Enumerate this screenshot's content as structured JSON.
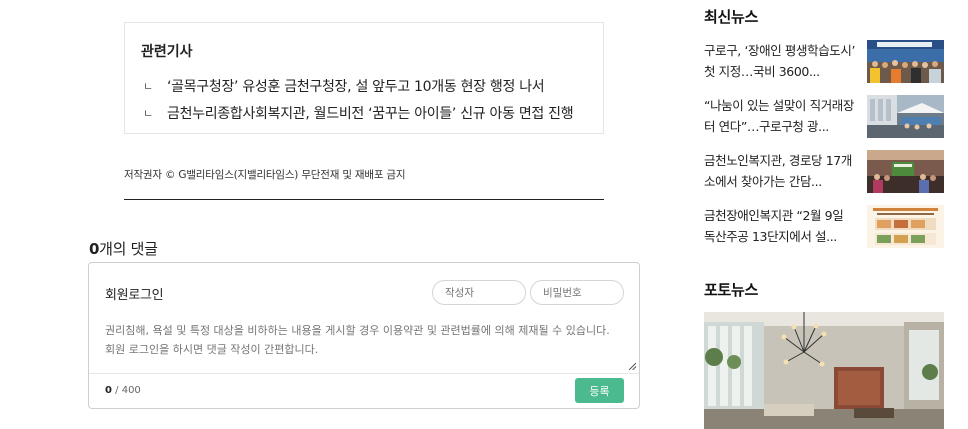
{
  "related": {
    "title": "관련기사",
    "items": [
      {
        "arrow": "ㄴ",
        "text": "‘골목구청장’ 유성훈 금천구청장, 설 앞두고 10개동 현장 행정 나서"
      },
      {
        "arrow": "ㄴ",
        "text": "금천누리종합사회복지관, 월드비전 ‘꿈꾸는 아이들’ 신규 아동 면접 진행"
      }
    ]
  },
  "copyright": "저작권자 © G밸리타임스(지밸리타임스) 무단전재 및 재배포 금지",
  "comments": {
    "count": "0",
    "count_suffix": "개의 댓글",
    "login_label": "회원로그인",
    "author_placeholder": "작성자",
    "password_placeholder": "비밀번호",
    "textarea_placeholder": "권리침해, 욕설 및 특정 대상을 비하하는 내용을 게시할 경우 이용약관 및 관련법률에 의해 제재될 수 있습니다. 회원 로그인을 하시면 댓글 작성이 간편합니다.",
    "char_count": "0",
    "char_max": "/ 400",
    "submit_label": "등록",
    "submit_color": "#4cba8f"
  },
  "sidebar": {
    "latest_title": "최신뉴스",
    "latest": [
      {
        "title": "구로구, ‘장애인 평생학습도시’ 첫 지정…국비 3600..."
      },
      {
        "title": "“나눔이 있는 설맞이 직거래장터 연다”…구로구청 광..."
      },
      {
        "title": "금천노인복지관, 경로당 17개소에서 찾아가는 간담..."
      },
      {
        "title": "금천장애인복지관 “2월 9일 독산주공 13단지에서 설..."
      }
    ],
    "photo_title": "포토뉴스"
  }
}
